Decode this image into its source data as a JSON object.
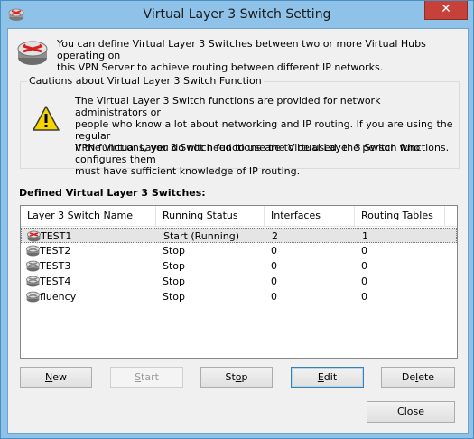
{
  "window": {
    "title": "Virtual Layer 3 Switch Setting",
    "close_glyph": "✕"
  },
  "intro": {
    "line1": "You can define Virtual Layer 3 Switches between two or more Virtual Hubs operating on",
    "line2": "this VPN Server to achieve routing between different IP networks."
  },
  "cautions": {
    "title": "Cautions about Virtual Layer 3 Switch Function",
    "p1_line1": "The Virtual Layer 3 Switch functions are provided for network administrators or",
    "p1_line2": "people who know a lot about networking and IP routing. If you are using the regular",
    "p1_line3": "VPN functions, you do not need to use the Virtual Layer 3 Switch functions.",
    "p2_line1": "If the Virtual Layer 3 Switch functions are to be used, the person who configures them",
    "p2_line2": "must have sufficient knowledge of IP routing."
  },
  "list": {
    "label": "Defined Virtual Layer 3 Switches:",
    "columns": [
      "Layer 3 Switch Name",
      "Running Status",
      "Interfaces",
      "Routing Tables"
    ],
    "rows": [
      {
        "name": "TEST1",
        "status": "Start (Running)",
        "interfaces": "2",
        "tables": "1",
        "running": true
      },
      {
        "name": "TEST2",
        "status": "Stop",
        "interfaces": "0",
        "tables": "0",
        "running": false
      },
      {
        "name": "TEST3",
        "status": "Stop",
        "interfaces": "0",
        "tables": "0",
        "running": false
      },
      {
        "name": "TEST4",
        "status": "Stop",
        "interfaces": "0",
        "tables": "0",
        "running": false
      },
      {
        "name": "fluency",
        "status": "Stop",
        "interfaces": "0",
        "tables": "0",
        "running": false
      }
    ]
  },
  "buttons": {
    "new_hot": "N",
    "new_rest": "ew",
    "start_hot": "S",
    "start_rest": "tart",
    "stop_pre": "St",
    "stop_hot": "o",
    "stop_post": "p",
    "edit_hot": "E",
    "edit_rest": "dit",
    "delete_pre": "De",
    "delete_hot": "l",
    "delete_post": "ete",
    "close_hot": "C",
    "close_rest": "lose"
  }
}
